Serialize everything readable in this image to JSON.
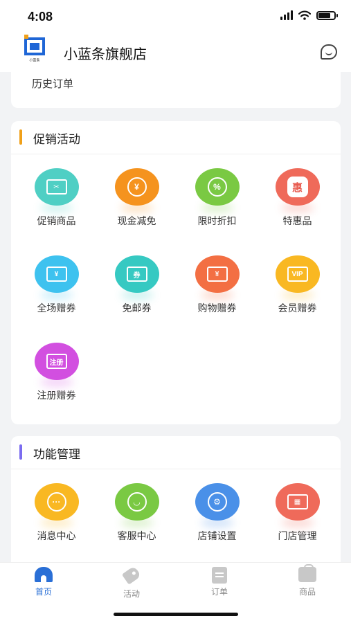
{
  "status_bar": {
    "time": "4:08"
  },
  "header": {
    "store_name": "小蓝条旗舰店",
    "logo_caption": "小蓝条"
  },
  "history": {
    "label": "历史订单"
  },
  "promotions": {
    "title": "促销活动",
    "accent": "#f0a019",
    "items": [
      {
        "label": "促销商品",
        "icon": "tag-icon",
        "color": "#4fcfc4",
        "glyph": "✂"
      },
      {
        "label": "现金减免",
        "icon": "yen-coin-icon",
        "color": "#f5931e",
        "glyph": "¥"
      },
      {
        "label": "限时折扣",
        "icon": "discount-icon",
        "color": "#7ac943",
        "glyph": "%"
      },
      {
        "label": "特惠品",
        "icon": "special-offer-icon",
        "color": "#ef6a5a",
        "glyph": "惠"
      },
      {
        "label": "全场赠券",
        "icon": "receipt-yen-icon",
        "color": "#3ec2ef",
        "glyph": "¥"
      },
      {
        "label": "免邮券",
        "icon": "free-shipping-coupon-icon",
        "color": "#36c9c2",
        "glyph": "券"
      },
      {
        "label": "购物赠券",
        "icon": "shopping-coupon-icon",
        "color": "#f36f43",
        "glyph": "¥"
      },
      {
        "label": "会员赠券",
        "icon": "vip-coupon-icon",
        "color": "#f9b822",
        "glyph": "VIP"
      },
      {
        "label": "注册赠券",
        "icon": "register-coupon-icon",
        "color": "#d24fe0",
        "glyph": "注册"
      }
    ]
  },
  "functions": {
    "title": "功能管理",
    "accent": "#7b6cf0",
    "items": [
      {
        "label": "消息中心",
        "icon": "message-icon",
        "color": "#f9b822",
        "glyph": "···"
      },
      {
        "label": "客服中心",
        "icon": "customer-service-icon",
        "color": "#7ac943",
        "glyph": "◡"
      },
      {
        "label": "店铺设置",
        "icon": "store-settings-icon",
        "color": "#4a90e8",
        "glyph": "⚙"
      },
      {
        "label": "门店管理",
        "icon": "store-management-icon",
        "color": "#ef6a5a",
        "glyph": "▦"
      }
    ]
  },
  "tab_bar": {
    "tabs": [
      {
        "label": "首页",
        "icon": "home-icon",
        "active": true
      },
      {
        "label": "活动",
        "icon": "tag-icon",
        "active": false
      },
      {
        "label": "订单",
        "icon": "order-icon",
        "active": false
      },
      {
        "label": "商品",
        "icon": "goods-icon",
        "active": false
      }
    ]
  }
}
